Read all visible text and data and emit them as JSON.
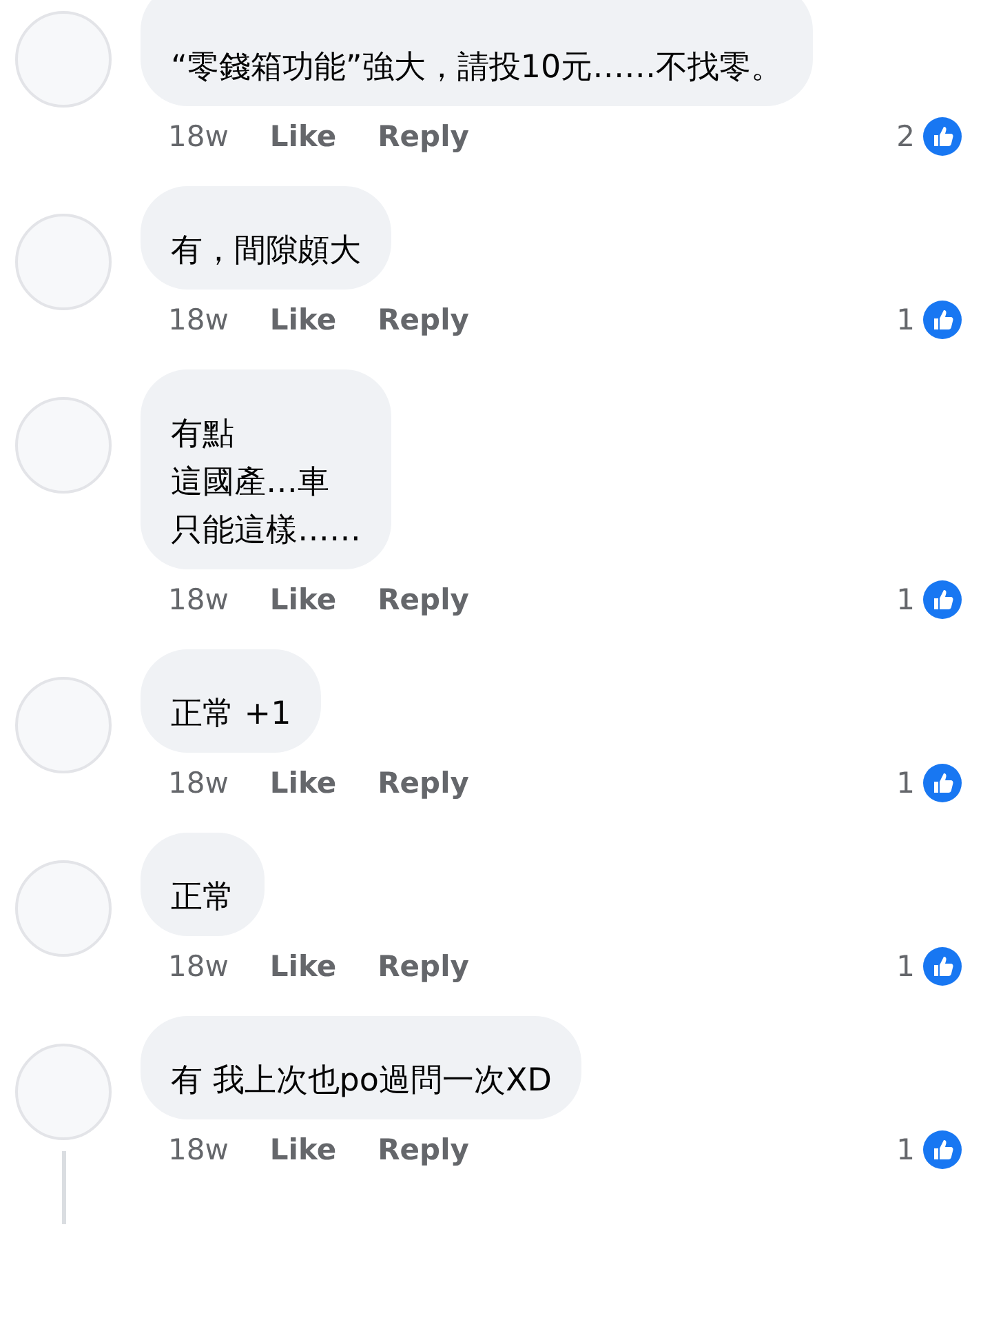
{
  "comments": [
    {
      "lines": [
        "“零錢箱功能”強大，請投10元……不找零。"
      ],
      "time": "18w",
      "like": "Like",
      "reply": "Reply",
      "reactions": "2",
      "thread": false
    },
    {
      "lines": [
        "有，間隙頗大"
      ],
      "time": "18w",
      "like": "Like",
      "reply": "Reply",
      "reactions": "1",
      "thread": false
    },
    {
      "lines": [
        "有點",
        "這國產…車",
        "只能這樣……"
      ],
      "time": "18w",
      "like": "Like",
      "reply": "Reply",
      "reactions": "1",
      "thread": false
    },
    {
      "lines": [
        "正常 +1"
      ],
      "time": "18w",
      "like": "Like",
      "reply": "Reply",
      "reactions": "1",
      "thread": false
    },
    {
      "lines": [
        "正常"
      ],
      "time": "18w",
      "like": "Like",
      "reply": "Reply",
      "reactions": "1",
      "thread": false
    },
    {
      "lines": [
        "有  我上次也po過問一次XD"
      ],
      "time": "18w",
      "like": "Like",
      "reply": "Reply",
      "reactions": "1",
      "thread": true
    }
  ]
}
